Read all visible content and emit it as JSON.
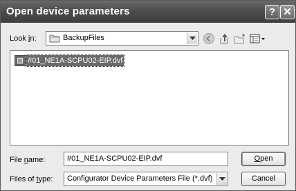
{
  "window": {
    "title": "Open device parameters",
    "help_label": "?",
    "close_label": "✕"
  },
  "look_in": {
    "label_prefix": "Look ",
    "label_hotkey": "i",
    "label_suffix": "n:",
    "value": "BackupFiles"
  },
  "files": [
    {
      "name": "#01_NE1A-SCPU02-EIP.dvf",
      "selected": true
    }
  ],
  "file_name": {
    "label_prefix": "File ",
    "label_hotkey": "n",
    "label_suffix": "ame:",
    "value": "#01_NE1A-SCPU02-EIP.dvf"
  },
  "file_type": {
    "label_prefix": "Files of ",
    "label_hotkey": "t",
    "label_suffix": "ype:",
    "value": "Configurator Device Parameters File (*.dvf)"
  },
  "buttons": {
    "open_hotkey": "O",
    "open_rest": "pen",
    "cancel": "Cancel"
  },
  "colors": {
    "titlebar": "#4d4d4d",
    "selection": "#6b6b6b"
  }
}
